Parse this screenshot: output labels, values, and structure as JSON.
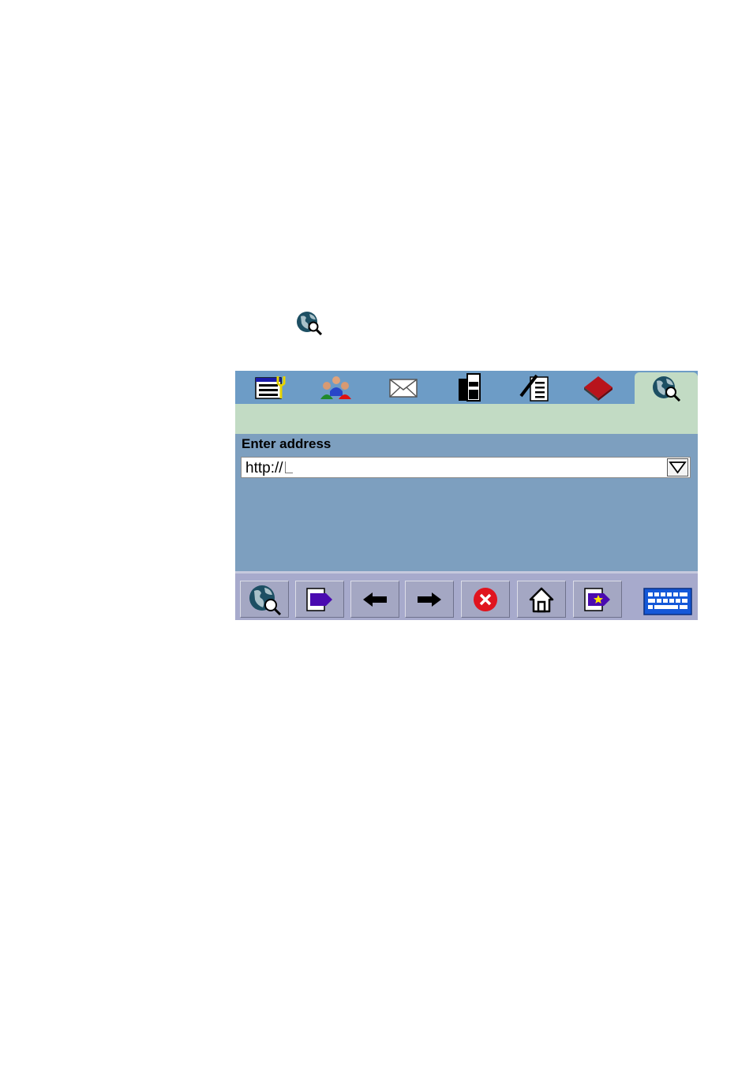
{
  "standalone_icon": "globe-search-icon",
  "tabs": [
    {
      "icon": "settings-list-icon",
      "active": false
    },
    {
      "icon": "contacts-group-icon",
      "active": false
    },
    {
      "icon": "mail-envelope-icon",
      "active": false
    },
    {
      "icon": "phone-icon",
      "active": false
    },
    {
      "icon": "notepad-icon",
      "active": false
    },
    {
      "icon": "book-icon",
      "active": false
    },
    {
      "icon": "globe-search-icon",
      "active": true
    }
  ],
  "address": {
    "label": "Enter address",
    "value": "http://"
  },
  "toolbar": {
    "buttons": [
      "globe-search-icon",
      "go-flag-icon",
      "arrow-left-icon",
      "arrow-right-icon",
      "stop-icon",
      "home-icon",
      "favorites-flag-icon"
    ],
    "keyboard": "keyboard-icon"
  },
  "colors": {
    "tabbar": "#6d9cc6",
    "strip": "#c2dbc4",
    "content": "#7d9fbf",
    "toolbar": "#a7aacc"
  }
}
